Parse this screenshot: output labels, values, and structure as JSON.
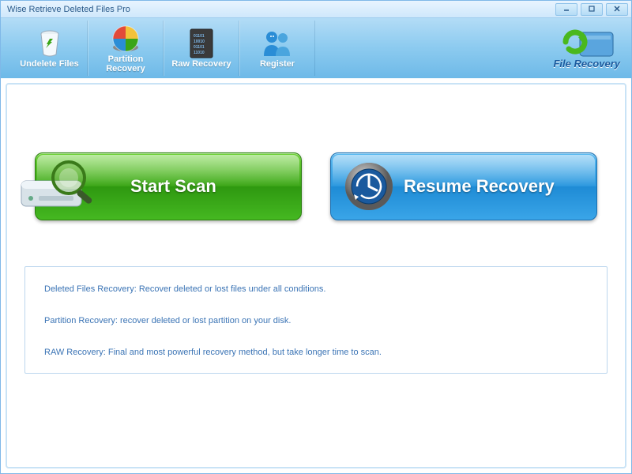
{
  "window": {
    "title": "Wise Retrieve Deleted Files Pro"
  },
  "toolbar": {
    "items": [
      {
        "label": "Undelete Files"
      },
      {
        "label": "Partition\nRecovery"
      },
      {
        "label": "Raw Recovery"
      },
      {
        "label": "Register"
      }
    ],
    "brand": "File Recovery"
  },
  "main": {
    "start_scan": "Start  Scan",
    "resume_recovery": "Resume Recovery"
  },
  "info": {
    "line1": "Deleted Files Recovery: Recover deleted or lost files  under all conditions.",
    "line2": "Partition Recovery: recover deleted or lost partition on your disk.",
    "line3": "RAW Recovery: Final and most powerful recovery method, but take longer time to scan."
  }
}
